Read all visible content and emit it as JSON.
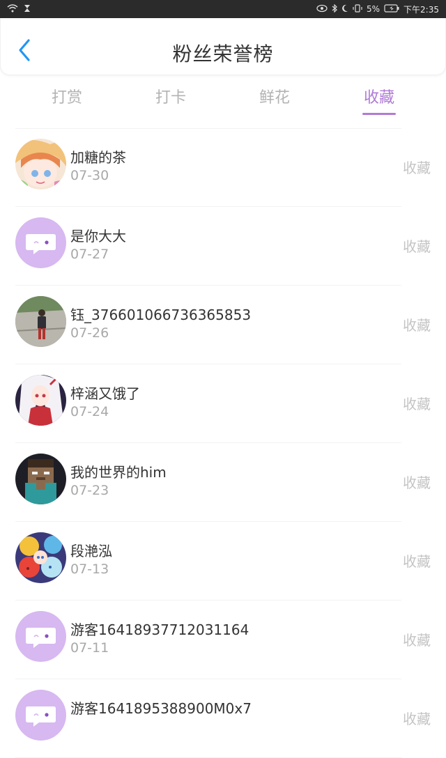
{
  "status_bar": {
    "battery": "5%",
    "time": "下午2:35"
  },
  "header": {
    "title": "粉丝荣誉榜"
  },
  "tabs": [
    {
      "label": "打赏"
    },
    {
      "label": "打卡"
    },
    {
      "label": "鲜花"
    },
    {
      "label": "收藏"
    }
  ],
  "active_tab": "收藏",
  "colors": {
    "accent": "#b07ad6",
    "back_arrow": "#2196f3",
    "default_avatar_bg": "#d7b8f0"
  },
  "items": [
    {
      "name": "加糖的茶",
      "date": "07-30",
      "action": "收藏",
      "avatar": "anime-avatar-1"
    },
    {
      "name": "是你大大",
      "date": "07-27",
      "action": "收藏",
      "avatar": "default-chat-avatar"
    },
    {
      "name": "钰_376601066736365853",
      "date": "07-26",
      "action": "收藏",
      "avatar": "photo-avatar"
    },
    {
      "name": "梓涵又饿了",
      "date": "07-24",
      "action": "收藏",
      "avatar": "anime-avatar-2"
    },
    {
      "name": "我的世界的him",
      "date": "07-23",
      "action": "收藏",
      "avatar": "blocky-avatar"
    },
    {
      "name": "段滟泓",
      "date": "07-13",
      "action": "收藏",
      "avatar": "anime-avatar-3"
    },
    {
      "name": "游客16418937712031164",
      "date": "07-11",
      "action": "收藏",
      "avatar": "default-chat-avatar"
    },
    {
      "name": "游客1641895388900M0x7",
      "date": "",
      "action": "收藏",
      "avatar": "default-chat-avatar"
    }
  ]
}
